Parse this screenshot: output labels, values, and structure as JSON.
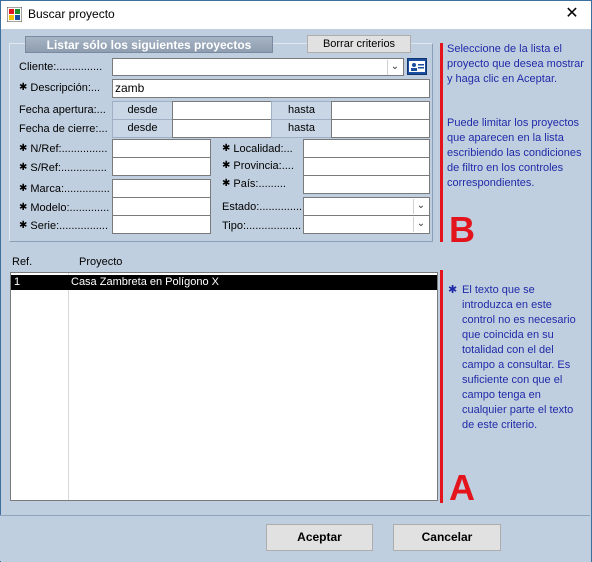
{
  "window": {
    "title": "Buscar proyecto",
    "close_glyph": "✕"
  },
  "filters": {
    "group_title": "Listar sólo los siguientes proyectos",
    "clear_button": "Borrar criterios",
    "cliente_label": "Cliente:...............",
    "cliente_value": "",
    "descripcion_label": "Descripción:...",
    "descripcion_value": "zamb",
    "fecha_apertura_label": "Fecha apertura:...",
    "fecha_cierre_label": "Fecha de cierre:...",
    "desde": "desde",
    "hasta": "hasta",
    "nref_label": "N/Ref:...............",
    "sref_label": "S/Ref:...............",
    "marca_label": "Marca:...............",
    "modelo_label": "Modelo:.............",
    "serie_label": "Serie:................",
    "localidad_label": "Localidad:...",
    "provincia_label": "Provincia:....",
    "pais_label": "País:.........",
    "estado_label": "Estado:..............",
    "tipo_label": "Tipo:..................",
    "star": "✱"
  },
  "help": {
    "top_para1": "Seleccione de la lista el proyecto que desea mostrar y haga clic en Aceptar.",
    "top_para2": "Puede limitar los proyectos que aparecen en la lista escribiendo las condiciones de filtro en los controles correspondientes.",
    "bottom_para": "El texto que se introduzca en este control no es necesario que coincida en su totalidad con el del campo a consultar. Es suficiente con que el campo tenga en cualquier parte el texto de este criterio.",
    "letter_b": "B",
    "letter_a": "A"
  },
  "list": {
    "col_ref": "Ref.",
    "col_proyecto": "Proyecto",
    "rows": [
      {
        "ref": "1",
        "proyecto": "Casa Zambreta en Polígono X"
      }
    ]
  },
  "buttons": {
    "accept": "Aceptar",
    "cancel": "Cancelar"
  },
  "colors": {
    "accent_red": "#e3141b",
    "help_text": "#1f2aa8"
  }
}
